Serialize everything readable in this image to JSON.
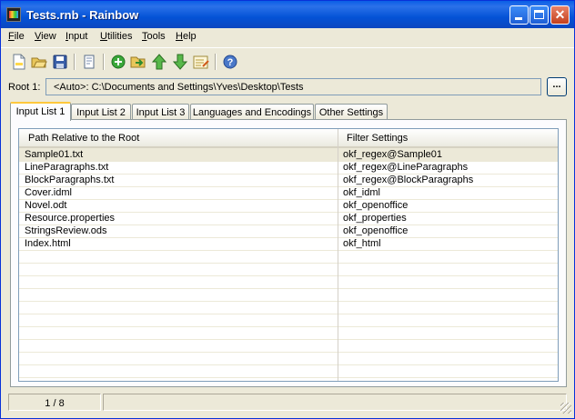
{
  "window": {
    "title": "Tests.rnb - Rainbow",
    "controls": {
      "minimize": "",
      "maximize": "",
      "close": "✕"
    }
  },
  "menu": [
    {
      "first": "F",
      "rest": "ile"
    },
    {
      "first": "V",
      "rest": "iew"
    },
    {
      "first": "I",
      "rest": "nput"
    },
    {
      "first": "U",
      "rest": "tilities"
    },
    {
      "first": "T",
      "rest": "ools"
    },
    {
      "first": "H",
      "rest": "elp"
    }
  ],
  "toolbar": {
    "icons": [
      "new-file-icon",
      "open-folder-icon",
      "save-icon",
      "edit-document-icon",
      "add-icon",
      "add-files-icon",
      "move-up-icon",
      "move-down-icon",
      "edit-settings-icon",
      "help-icon"
    ]
  },
  "root": {
    "label": "Root 1:",
    "value": "<Auto>:  C:\\Documents and Settings\\Yves\\Desktop\\Tests",
    "browse": "..."
  },
  "tabs": [
    "Input List 1",
    "Input List 2",
    "Input List 3",
    "Languages and Encodings",
    "Other Settings"
  ],
  "table": {
    "headers": [
      "Path Relative to the Root",
      "Filter Settings"
    ],
    "rows": [
      [
        "Sample01.txt",
        "okf_regex@Sample01"
      ],
      [
        "LineParagraphs.txt",
        "okf_regex@LineParagraphs"
      ],
      [
        "BlockParagraphs.txt",
        "okf_regex@BlockParagraphs"
      ],
      [
        "Cover.idml",
        "okf_idml"
      ],
      [
        "Novel.odt",
        "okf_openoffice"
      ],
      [
        "Resource.properties",
        "okf_properties"
      ],
      [
        "StringsReview.ods",
        "okf_openoffice"
      ],
      [
        "Index.html",
        "okf_html"
      ]
    ]
  },
  "status": {
    "count": "1 / 8",
    "message": ""
  },
  "colors": {
    "title_bar": "#0453d6",
    "face": "#ece9d8",
    "active_tab_accent": "#ffc83c"
  }
}
